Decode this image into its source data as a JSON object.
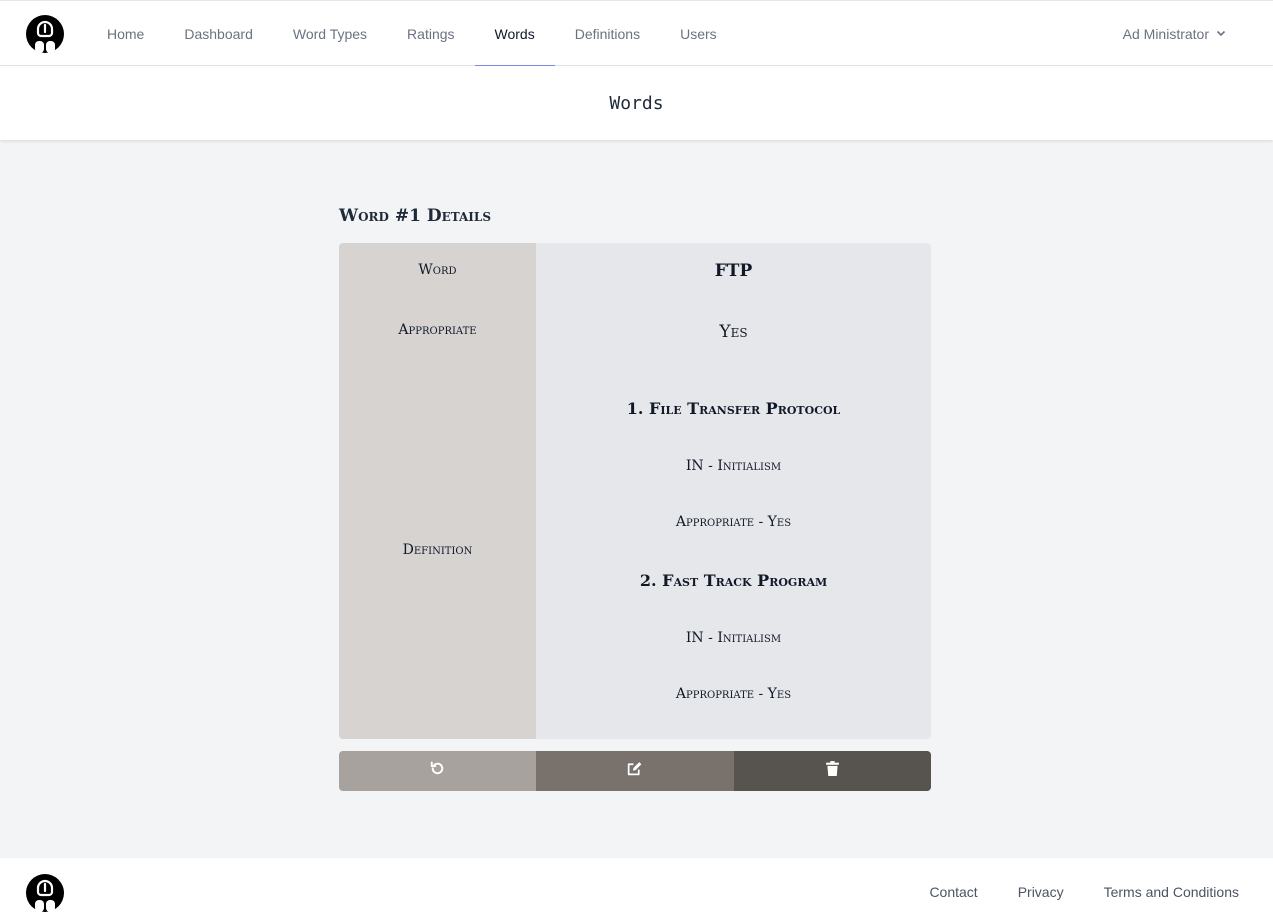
{
  "nav": {
    "items": [
      {
        "label": "Home",
        "active": false
      },
      {
        "label": "Dashboard",
        "active": false
      },
      {
        "label": "Word Types",
        "active": false
      },
      {
        "label": "Ratings",
        "active": false
      },
      {
        "label": "Words",
        "active": true
      },
      {
        "label": "Definitions",
        "active": false
      },
      {
        "label": "Users",
        "active": false
      }
    ],
    "user_name": "Ad Ministrator",
    "logo_icon": "logo-icon",
    "user_chevron_icon": "chevron-down-icon"
  },
  "page": {
    "title": "Words"
  },
  "details": {
    "heading": "Word #1 Details",
    "labels": {
      "word": "Word",
      "appropriate": "Appropriate",
      "definition": "Definition"
    },
    "word": "FTP",
    "appropriate": "Yes",
    "definitions": [
      {
        "title": "1. File Transfer Protocol",
        "type": "IN - Initialism",
        "appropriate": "Appropriate - Yes"
      },
      {
        "title": "2. Fast Track Program",
        "type": "IN - Initialism",
        "appropriate": "Appropriate - Yes"
      }
    ]
  },
  "actions": {
    "back_icon": "undo-icon",
    "edit_icon": "edit-icon",
    "delete_icon": "trash-icon"
  },
  "footer": {
    "links": [
      "Contact",
      "Privacy",
      "Terms and Conditions"
    ]
  },
  "colors": {
    "active_underline": "#818cf8",
    "card_label_bg": "#d6d3d1",
    "card_value_bg": "#e5e7eb",
    "back_button": "#a8a29e",
    "edit_button": "#78716c",
    "delete_button": "#57534e"
  }
}
